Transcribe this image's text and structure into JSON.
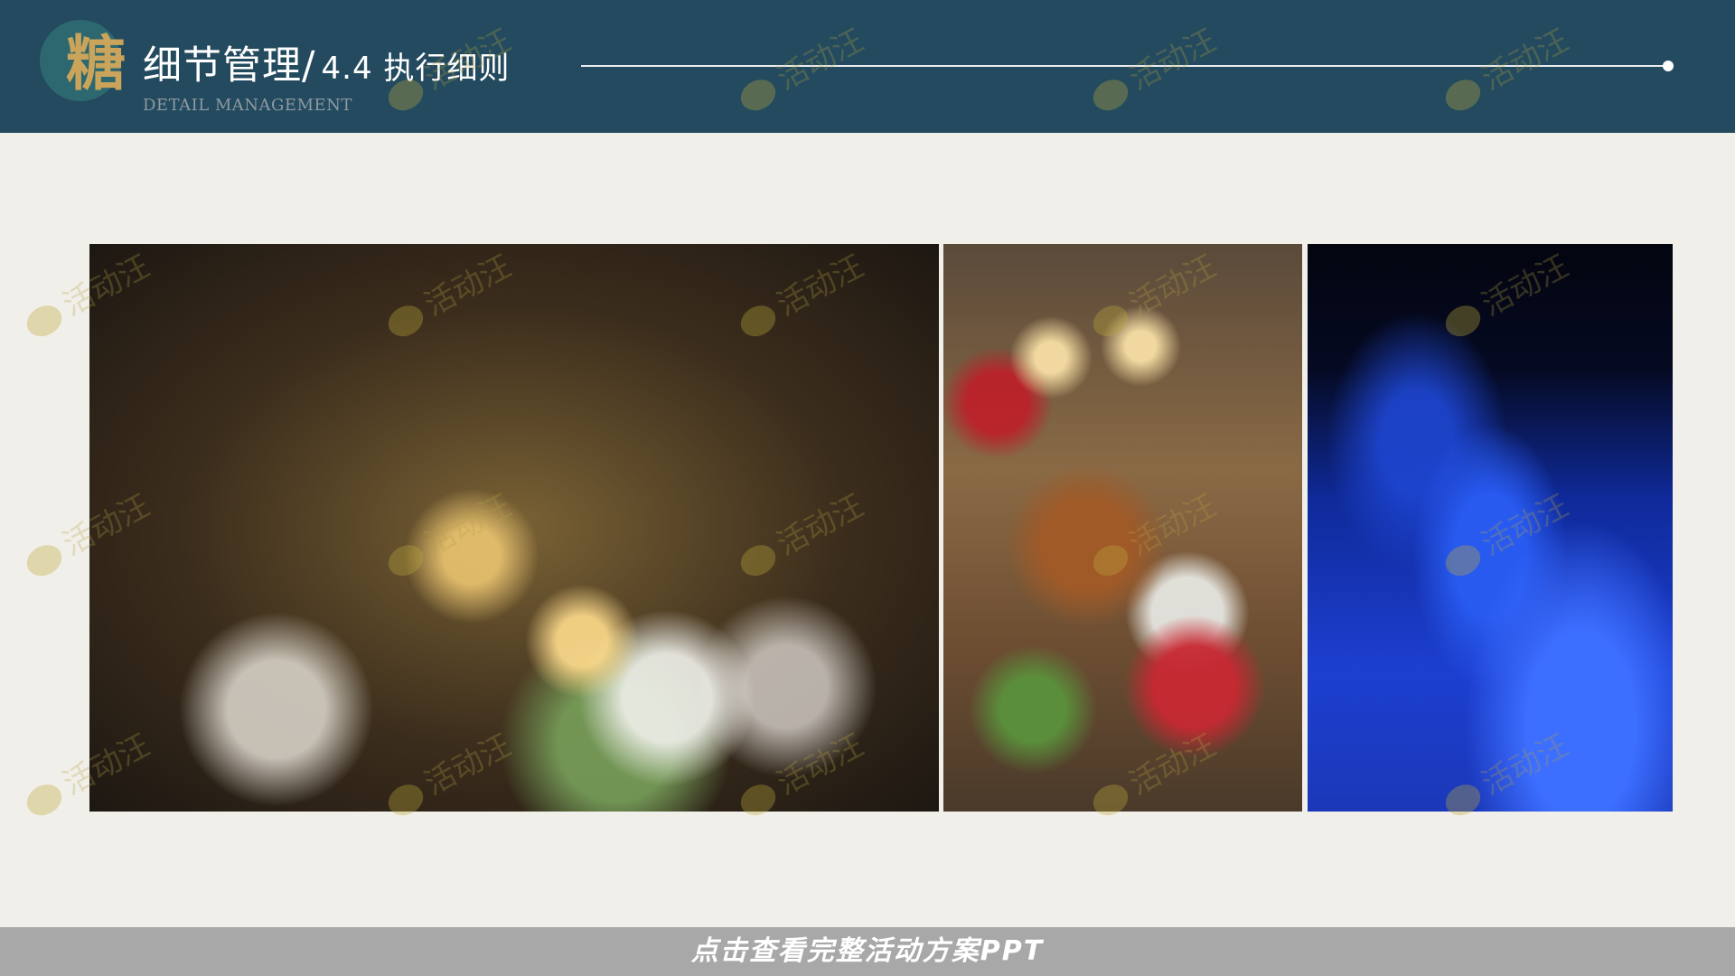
{
  "header": {
    "logo_char": "糖",
    "title_main": "细节管理/",
    "title_sub": "4.4 执行细则",
    "subtitle_en": "DETAIL MANAGEMENT"
  },
  "photos": [
    {
      "name": "banquet-long-table-photo"
    },
    {
      "name": "christmas-feast-table-photo"
    },
    {
      "name": "blue-lit-gala-table-photo"
    }
  ],
  "watermark": {
    "text": "活动汪"
  },
  "footer": {
    "cta_text": "点击查看完整活动方案PPT"
  },
  "colors": {
    "header_bg": "#234a5e",
    "page_bg": "#f1efe9",
    "footer_bg": "#a8a8a8",
    "accent_gold": "#c9a45a"
  }
}
